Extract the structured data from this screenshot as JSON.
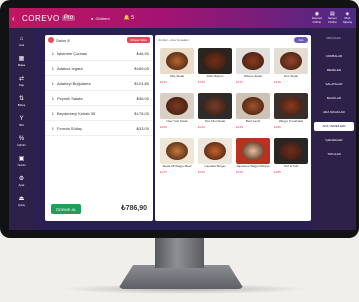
{
  "app": {
    "logo": "COREVO",
    "logo_badge": "Pro",
    "user": "Görkem",
    "notifications": "5"
  },
  "topbar_stats": [
    {
      "icon": "wifi-icon",
      "label": "İnternet",
      "value": "Online"
    },
    {
      "icon": "server-icon",
      "label": "Server",
      "value": "Online"
    },
    {
      "icon": "mode-icon",
      "label": "Mod",
      "value": "Sipariş"
    }
  ],
  "nav": [
    {
      "icon": "home-icon",
      "glyph": "⌂",
      "label": "Ana"
    },
    {
      "icon": "receipt-icon",
      "glyph": "▦",
      "label": "Masa"
    },
    {
      "icon": "transfer-icon",
      "glyph": "⇄",
      "label": "Taşı"
    },
    {
      "icon": "merge-icon",
      "glyph": "⇅",
      "label": "Birleş"
    },
    {
      "icon": "split-icon",
      "glyph": "Y",
      "label": "Böl"
    },
    {
      "icon": "discount-icon",
      "glyph": "%",
      "label": "İndirim"
    },
    {
      "icon": "print-icon",
      "glyph": "▣",
      "label": "Yazdır"
    },
    {
      "icon": "settings-icon",
      "glyph": "⚙",
      "label": "Ayar"
    },
    {
      "icon": "exit-icon",
      "glyph": "⏏",
      "label": "Çıkış"
    }
  ],
  "order": {
    "table_label": "Salon 8",
    "add_customer": "Müşteri Ekle",
    "rows": [
      {
        "qty": "1",
        "name": "İşkembe Çorbası",
        "price": "₺46,50"
      },
      {
        "qty": "1",
        "name": "Adakoz Izgara",
        "price": "₺189,00"
      },
      {
        "qty": "1",
        "name": "Adabeyi Buğulama",
        "price": "₺124,80"
      },
      {
        "qty": "1",
        "name": "Peynirli Salata",
        "price": "₺56,00"
      },
      {
        "qty": "1",
        "name": "Beyderbeyi Kebab 35",
        "price": "₺178,00"
      },
      {
        "qty": "1",
        "name": "Fırında Sütlaç",
        "price": "₺33,00"
      }
    ],
    "pay_label": "ÖDEME AL",
    "total": "₺786,90"
  },
  "catalog": {
    "breadcrumb": "Ürünler  ›  Ana Yemekler",
    "search_label": "Ara",
    "items": [
      {
        "name": "Piliç Steak",
        "price": "₺215"
      },
      {
        "name": "Fileli Mignon",
        "price": "₺189"
      },
      {
        "name": "Ribeye Steak",
        "price": "₺245"
      },
      {
        "name": "Dox Steak",
        "price": "₺199"
      },
      {
        "name": "New York Steak",
        "price": "₺256"
      },
      {
        "name": "Dox Filet Steak",
        "price": "₺210"
      },
      {
        "name": "Beef Lamb",
        "price": "₺235"
      },
      {
        "name": "Wagyu Tomahawk",
        "price": "₺295"
      },
      {
        "name": "Steak 28 Wagyu Beef",
        "price": "₺275"
      },
      {
        "name": "Camada Burger",
        "price": "₺165"
      },
      {
        "name": "Japanese Wagyu Ribeye",
        "price": "₺315"
      },
      {
        "name": "Turf & Surf",
        "price": "₺285"
      }
    ]
  },
  "categories": {
    "title": "MENÜLER",
    "items": [
      "ÇORBALAR",
      "MEZELER",
      "SALATALAR",
      "BALIKLAR",
      "ARA SICAKLAR",
      "ANA YEMEKLER",
      "İÇECEKLER",
      "TATLILAR"
    ],
    "active": "ANA YEMEKLER"
  },
  "colors": {
    "accent": "#e8465a",
    "primary": "#2d2049",
    "success": "#20a05a"
  }
}
